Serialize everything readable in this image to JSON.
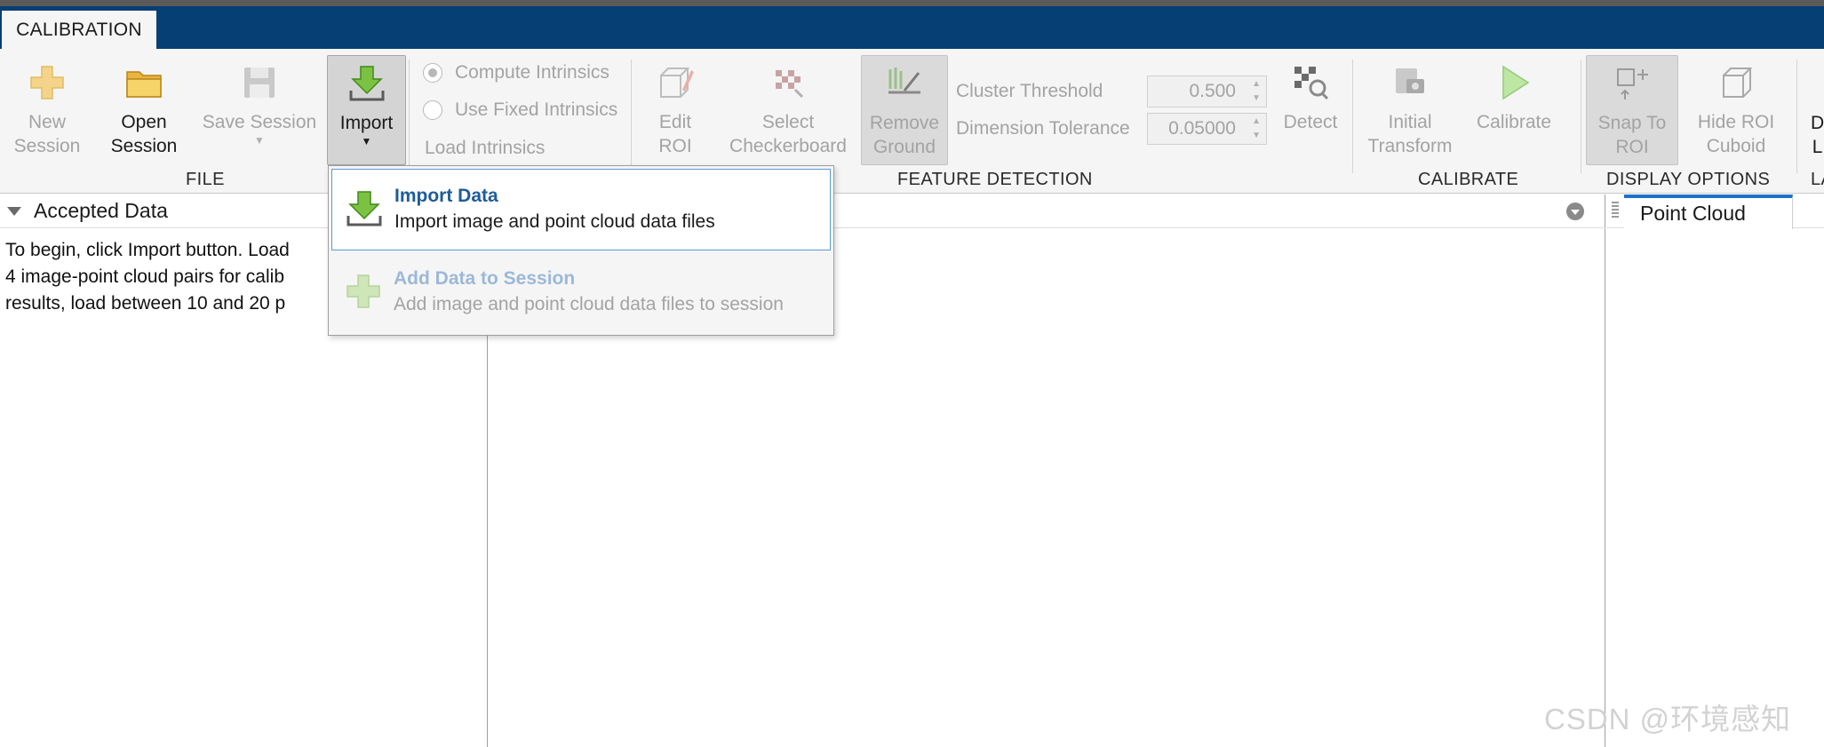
{
  "tabs": {
    "calibration": "CALIBRATION"
  },
  "ribbon": {
    "file": {
      "section": "FILE",
      "new_session": "New\nSession",
      "open_session": "Open\nSession",
      "save_session": "Save Session",
      "import": "Import"
    },
    "intrinsics": {
      "compute": "Compute Intrinsics",
      "use_fixed": "Use Fixed Intrinsics",
      "load": "Load Intrinsics"
    },
    "feature_detection": {
      "section": "FEATURE DETECTION",
      "edit_roi": "Edit\nROI",
      "select_checkerboard": "Select\nCheckerboard",
      "remove_ground": "Remove\nGround",
      "cluster_threshold_label": "Cluster Threshold",
      "cluster_threshold_value": "0.500",
      "dimension_tolerance_label": "Dimension Tolerance",
      "dimension_tolerance_value": "0.05000",
      "detect": "Detect"
    },
    "calibrate": {
      "section": "CALIBRATE",
      "initial_transform": "Initial\nTransform",
      "calibrate": "Calibrate"
    },
    "display_options": {
      "section": "DISPLAY OPTIONS",
      "snap_to_roi": "Snap To\nROI",
      "hide_roi_cuboid": "Hide ROI\nCuboid",
      "clipped_label": "D\nL",
      "clipped_section": "LA"
    }
  },
  "left_panel": {
    "title": "Accepted Data",
    "line1": "To begin, click Import button. Load",
    "line2": "4 image-point cloud pairs for calib",
    "line3": "results, load between 10 and 20 p"
  },
  "right_panel": {
    "tab": "Point Cloud"
  },
  "import_menu": {
    "item1_title": "Import Data",
    "item1_desc": "Import image and point cloud data files",
    "item2_title": "Add Data to Session",
    "item2_desc": "Add image and point cloud data files to session"
  },
  "watermark": "CSDN @环境感知",
  "colors": {
    "tabstrip": "#063f73",
    "accent": "#1d72c8",
    "menu_title": "#1e5c99"
  }
}
